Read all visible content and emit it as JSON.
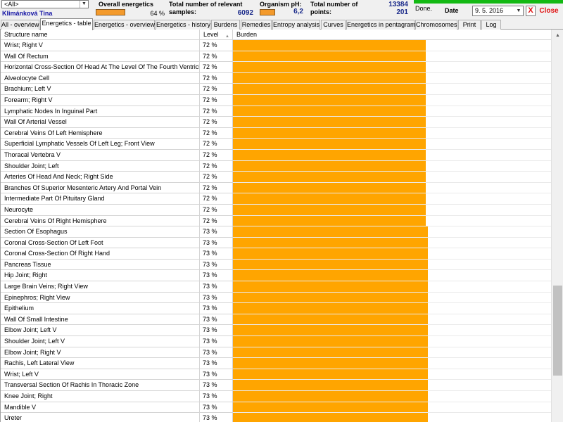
{
  "header": {
    "filter_value": "<All>",
    "patient_name": "Klimánková Tina",
    "overall_label": "Overall energetics",
    "overall_value": "64 %",
    "overall_percent": 64,
    "samples_label_1": "Total number of relevant",
    "samples_label_2": "samples:",
    "samples_value": "6092",
    "ph_label": "Organism pH:",
    "ph_value": "6,2",
    "points_label_1": "Total number of",
    "points_label_2": "points:",
    "points_value_1": "13384",
    "points_value_2": "201",
    "status_text": "Done.",
    "date_label": "Date",
    "date_value": "9. 5. 2016",
    "close_x": "X",
    "close_label": "Close",
    "accent_color": "#f39a2c",
    "progress_color": "#13b913"
  },
  "tabs": [
    {
      "label": "All - overview"
    },
    {
      "label": "Energetics - table"
    },
    {
      "label": "Energetics - overview"
    },
    {
      "label": "Energetics - history"
    },
    {
      "label": "Burdens"
    },
    {
      "label": "Remedies"
    },
    {
      "label": "Entropy analysis"
    },
    {
      "label": "Curves"
    },
    {
      "label": "Energetics in pentagram"
    },
    {
      "label": "Chromosomes"
    },
    {
      "label": "Print"
    },
    {
      "label": "Log"
    }
  ],
  "active_tab": 1,
  "table": {
    "columns": {
      "name": "Structure name",
      "level": "Level",
      "burden": "Burden"
    },
    "bar_color": "#ffa500",
    "rows": [
      {
        "name": "Wrist; Right V",
        "level": "72 %",
        "level_value": 72
      },
      {
        "name": "Wall Of Rectum",
        "level": "72 %",
        "level_value": 72
      },
      {
        "name": "Horizontal Cross-Section Of Head At The Level Of The Fourth Ventricle",
        "level": "72 %",
        "level_value": 72
      },
      {
        "name": "Alveolocyte Cell",
        "level": "72 %",
        "level_value": 72
      },
      {
        "name": "Brachium; Left V",
        "level": "72 %",
        "level_value": 72
      },
      {
        "name": "Forearm; Right V",
        "level": "72 %",
        "level_value": 72
      },
      {
        "name": "Lymphatic Nodes In Inguinal Part",
        "level": "72 %",
        "level_value": 72
      },
      {
        "name": "Wall Of Arterial Vessel",
        "level": "72 %",
        "level_value": 72
      },
      {
        "name": "Cerebral Veins Of Left Hemisphere",
        "level": "72 %",
        "level_value": 72
      },
      {
        "name": "Superficial Lymphatic Vessels Of Left Leg; Front View",
        "level": "72 %",
        "level_value": 72
      },
      {
        "name": "Thoracal Vertebra V",
        "level": "72 %",
        "level_value": 72
      },
      {
        "name": "Shoulder Joint; Left",
        "level": "72 %",
        "level_value": 72
      },
      {
        "name": "Arteries Of Head And Neck; Right Side",
        "level": "72 %",
        "level_value": 72
      },
      {
        "name": "Branches Of Superior Mesenteric Artery And Portal Vein",
        "level": "72 %",
        "level_value": 72
      },
      {
        "name": "Intermediate Part Of Pituitary Gland",
        "level": "72 %",
        "level_value": 72
      },
      {
        "name": "Neurocyte",
        "level": "72 %",
        "level_value": 72
      },
      {
        "name": "Cerebral Veins Of Right Hemisphere",
        "level": "72 %",
        "level_value": 72
      },
      {
        "name": "Section Of Esophagus",
        "level": "73 %",
        "level_value": 73
      },
      {
        "name": "Coronal Cross-Section Of Left Foot",
        "level": "73 %",
        "level_value": 73
      },
      {
        "name": "Coronal Cross-Section Of Right Hand",
        "level": "73 %",
        "level_value": 73
      },
      {
        "name": "Pancreas Tissue",
        "level": "73 %",
        "level_value": 73
      },
      {
        "name": "Hip Joint; Right",
        "level": "73 %",
        "level_value": 73
      },
      {
        "name": "Large Brain Veins; Right View",
        "level": "73 %",
        "level_value": 73
      },
      {
        "name": "Epinephros; Right View",
        "level": "73 %",
        "level_value": 73
      },
      {
        "name": "Epithelium",
        "level": "73 %",
        "level_value": 73
      },
      {
        "name": "Wall Of Small Intestine",
        "level": "73 %",
        "level_value": 73
      },
      {
        "name": "Elbow Joint; Left V",
        "level": "73 %",
        "level_value": 73
      },
      {
        "name": "Shoulder Joint; Left V",
        "level": "73 %",
        "level_value": 73
      },
      {
        "name": "Elbow Joint; Right V",
        "level": "73 %",
        "level_value": 73
      },
      {
        "name": "Rachis, Left Lateral View",
        "level": "73 %",
        "level_value": 73
      },
      {
        "name": "Wrist; Left V",
        "level": "73 %",
        "level_value": 73
      },
      {
        "name": "Transversal Section Of Rachis In Thoracic Zone",
        "level": "73 %",
        "level_value": 73
      },
      {
        "name": "Knee Joint; Right",
        "level": "73 %",
        "level_value": 73
      },
      {
        "name": "Mandible V",
        "level": "73 %",
        "level_value": 73
      },
      {
        "name": "Ureter",
        "level": "73 %",
        "level_value": 73
      }
    ]
  }
}
